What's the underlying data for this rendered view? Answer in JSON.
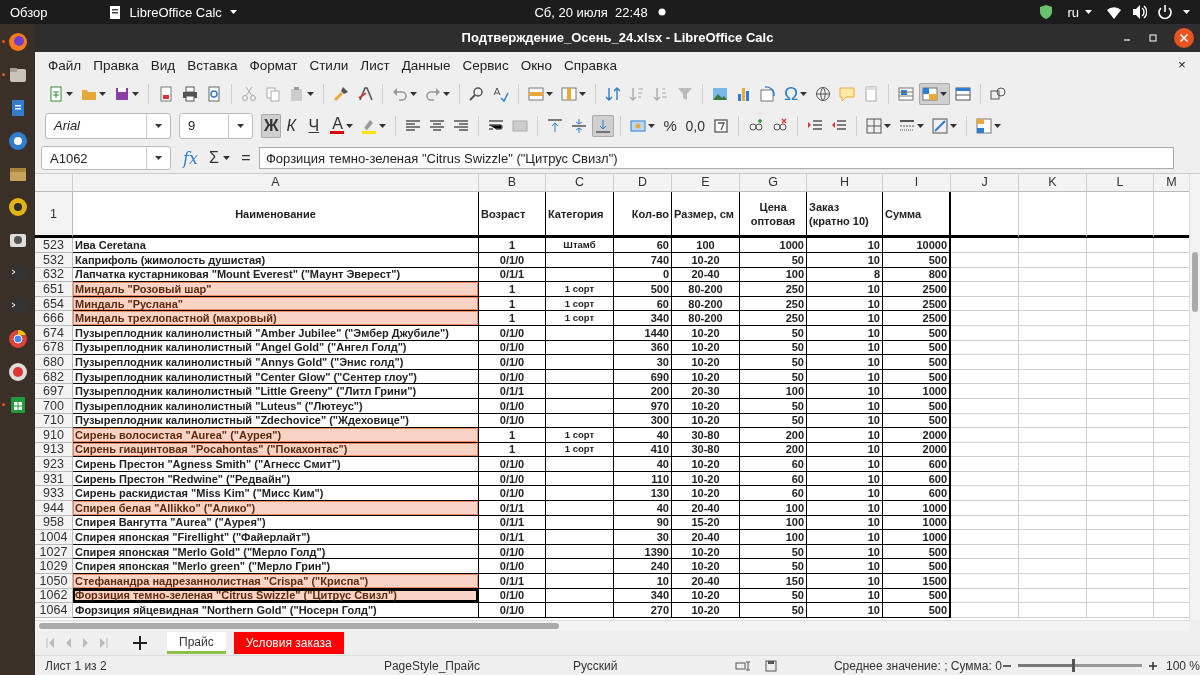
{
  "top_bar": {
    "activities": "Обзор",
    "app_name": "LibreOffice Calc",
    "clock": "Сб, 20 июля  22:48",
    "keyboard_layout": "ru"
  },
  "window": {
    "title": "Подтверждение_Осень_24.xlsx - LibreOffice Calc"
  },
  "menu": [
    "Файл",
    "Правка",
    "Вид",
    "Вставка",
    "Формат",
    "Стили",
    "Лист",
    "Данные",
    "Сервис",
    "Окно",
    "Справка"
  ],
  "menu_close": "×",
  "toolbar": {
    "special_character": "Ω"
  },
  "formatting": {
    "font_name": "Arial",
    "font_size": "9",
    "style_buttons": [
      {
        "label": "Ж",
        "kind": "bold",
        "on": true
      },
      {
        "label": "К",
        "kind": "italic",
        "on": false
      },
      {
        "label": "Ч",
        "kind": "underline",
        "on": false
      }
    ],
    "font_color_label": "A",
    "vertical_align_buttons": [
      {
        "kind": "top",
        "on": false
      },
      {
        "kind": "center",
        "on": false
      },
      {
        "kind": "bottom",
        "on": true
      }
    ],
    "percent": "%",
    "number_format": "0,0"
  },
  "formula_bar": {
    "name_box": "A1062",
    "function_wizard": "fx",
    "sum": "Σ",
    "equals": "=",
    "content": "Форзиция темно-зеленая \"Citrus Swizzle\" (\"Цитрус Свизл\")"
  },
  "columns": [
    "A",
    "B",
    "C",
    "D",
    "E",
    "G",
    "H",
    "I",
    "J",
    "K",
    "L",
    "M"
  ],
  "header_row": {
    "number": "1",
    "cells": [
      "Наименование",
      "Возраст",
      "Категория",
      "Кол-во",
      "Размер, см",
      "Цена оптовая",
      "Заказ (кратно 10)",
      "Сумма"
    ]
  },
  "rows": [
    {
      "number": "523",
      "highlight": false,
      "selected": false,
      "cells": {
        "A": "Ива Ceretana",
        "B": "1",
        "C": "Штамб",
        "D": "60",
        "E": "100",
        "G": "1000",
        "H": "10",
        "I": "10000"
      }
    },
    {
      "number": "532",
      "highlight": false,
      "selected": false,
      "cells": {
        "A": "Каприфоль (жимолость душистая)",
        "B": "0/1/0",
        "D": "740",
        "E": "10-20",
        "G": "50",
        "H": "10",
        "I": "500"
      }
    },
    {
      "number": "632",
      "highlight": false,
      "selected": false,
      "cells": {
        "A": "Лапчатка кустарниковая \"Mount Everest\" (\"Маунт Эверест\")",
        "B": "0/1/1",
        "D": "0",
        "E": "20-40",
        "G": "100",
        "H": "8",
        "I": "800"
      }
    },
    {
      "number": "651",
      "highlight": true,
      "selected": false,
      "cells": {
        "A": "Миндаль \"Розовый шар\"",
        "B": "1",
        "C": "1 сорт",
        "D": "500",
        "E": "80-200",
        "G": "250",
        "H": "10",
        "I": "2500"
      }
    },
    {
      "number": "654",
      "highlight": true,
      "selected": false,
      "cells": {
        "A": "Миндаль \"Руслана\"",
        "B": "1",
        "C": "1 сорт",
        "D": "60",
        "E": "80-200",
        "G": "250",
        "H": "10",
        "I": "2500"
      }
    },
    {
      "number": "666",
      "highlight": true,
      "selected": false,
      "cells": {
        "A": "Миндаль трехлопастной (махровый)",
        "B": "1",
        "C": "1 сорт",
        "D": "340",
        "E": "80-200",
        "G": "250",
        "H": "10",
        "I": "2500"
      }
    },
    {
      "number": "674",
      "highlight": false,
      "selected": false,
      "cells": {
        "A": "Пузыреплодник калинолистный \"Amber Jubilee\" (\"Эмбер Джубиле\")",
        "B": "0/1/0",
        "D": "1440",
        "E": "10-20",
        "G": "50",
        "H": "10",
        "I": "500"
      }
    },
    {
      "number": "678",
      "highlight": false,
      "selected": false,
      "cells": {
        "A": "Пузыреплодник калинолистный \"Angel Gold\" (\"Ангел Голд\")",
        "B": "0/1/0",
        "D": "360",
        "E": "10-20",
        "G": "50",
        "H": "10",
        "I": "500"
      }
    },
    {
      "number": "680",
      "highlight": false,
      "selected": false,
      "cells": {
        "A": "Пузыреплодник калинолистный \"Annys Gold\" (\"Энис голд\")",
        "B": "0/1/0",
        "D": "30",
        "E": "10-20",
        "G": "50",
        "H": "10",
        "I": "500"
      }
    },
    {
      "number": "682",
      "highlight": false,
      "selected": false,
      "cells": {
        "A": "Пузыреплодник калинолистный \"Center Glow\" (\"Сентер глоу\")",
        "B": "0/1/0",
        "D": "690",
        "E": "10-20",
        "G": "50",
        "H": "10",
        "I": "500"
      }
    },
    {
      "number": "697",
      "highlight": false,
      "selected": false,
      "cells": {
        "A": "Пузыреплодник калинолистный \"Little Greeny\" (\"Литл Грини\")",
        "B": "0/1/1",
        "D": "200",
        "E": "20-30",
        "G": "100",
        "H": "10",
        "I": "1000"
      }
    },
    {
      "number": "700",
      "highlight": false,
      "selected": false,
      "cells": {
        "A": "Пузыреплодник калинолистный \"Luteus\" (\"Лютеус\")",
        "B": "0/1/0",
        "D": "970",
        "E": "10-20",
        "G": "50",
        "H": "10",
        "I": "500"
      }
    },
    {
      "number": "710",
      "highlight": false,
      "selected": false,
      "cells": {
        "A": "Пузыреплодник калинолистный \"Zdechovice\" (\"Ждеховице\")",
        "B": "0/1/0",
        "D": "300",
        "E": "10-20",
        "G": "50",
        "H": "10",
        "I": "500"
      }
    },
    {
      "number": "910",
      "highlight": true,
      "selected": false,
      "cells": {
        "A": "Сирень волосистая \"Aurea\" (\"Аурея\")",
        "B": "1",
        "C": "1 сорт",
        "D": "40",
        "E": "30-80",
        "G": "200",
        "H": "10",
        "I": "2000"
      }
    },
    {
      "number": "913",
      "highlight": true,
      "selected": false,
      "cells": {
        "A": "Сирень гиацинтовая \"Pocahontas\" (\"Покахонтас\")",
        "B": "1",
        "C": "1 сорт",
        "D": "410",
        "E": "30-80",
        "G": "200",
        "H": "10",
        "I": "2000"
      }
    },
    {
      "number": "923",
      "highlight": false,
      "selected": false,
      "cells": {
        "A": "Сирень Престон \"Agness Smith\" (\"Агнесс Смит\")",
        "B": "0/1/0",
        "D": "40",
        "E": "10-20",
        "G": "60",
        "H": "10",
        "I": "600"
      }
    },
    {
      "number": "931",
      "highlight": false,
      "selected": false,
      "cells": {
        "A": "Сирень Престон \"Redwine\" (\"Редвайн\")",
        "B": "0/1/0",
        "D": "110",
        "E": "10-20",
        "G": "60",
        "H": "10",
        "I": "600"
      }
    },
    {
      "number": "933",
      "highlight": false,
      "selected": false,
      "cells": {
        "A": "Сирень раскидистая \"Miss Kim\" (\"Мисс Ким\")",
        "B": "0/1/0",
        "D": "130",
        "E": "10-20",
        "G": "60",
        "H": "10",
        "I": "600"
      }
    },
    {
      "number": "944",
      "highlight": true,
      "selected": false,
      "cells": {
        "A": "Спирея белая \"Allikko\" (\"Алико\")",
        "B": "0/1/1",
        "D": "40",
        "E": "20-40",
        "G": "100",
        "H": "10",
        "I": "1000"
      }
    },
    {
      "number": "958",
      "highlight": false,
      "selected": false,
      "cells": {
        "A": "Спирея Вангутта \"Aurea\" (\"Аурея\")",
        "B": "0/1/1",
        "D": "90",
        "E": "15-20",
        "G": "100",
        "H": "10",
        "I": "1000"
      }
    },
    {
      "number": "1004",
      "highlight": false,
      "selected": false,
      "cells": {
        "A": "Спирея японская \"Firellight\" (\"Файерлайт\")",
        "B": "0/1/1",
        "D": "30",
        "E": "20-40",
        "G": "100",
        "H": "10",
        "I": "1000"
      }
    },
    {
      "number": "1027",
      "highlight": false,
      "selected": false,
      "cells": {
        "A": "Спирея японская \"Merlo Gold\" (\"Мерло Голд\")",
        "B": "0/1/0",
        "D": "1390",
        "E": "10-20",
        "G": "50",
        "H": "10",
        "I": "500"
      }
    },
    {
      "number": "1029",
      "highlight": false,
      "selected": false,
      "cells": {
        "A": "Спирея японская \"Merlo green\" (\"Мерло Грин\")",
        "B": "0/1/0",
        "D": "240",
        "E": "10-20",
        "G": "50",
        "H": "10",
        "I": "500"
      }
    },
    {
      "number": "1050",
      "highlight": true,
      "selected": false,
      "cells": {
        "A": "Стефанандра надрезаннолистная \"Crispa\" (\"Криспа\")",
        "B": "0/1/1",
        "D": "10",
        "E": "20-40",
        "G": "150",
        "H": "10",
        "I": "1500"
      }
    },
    {
      "number": "1062",
      "highlight": true,
      "selected": true,
      "cells": {
        "A": "Форзиция темно-зеленая \"Citrus Swizzle\" (\"Цитрус Свизл\")",
        "B": "0/1/0",
        "D": "340",
        "E": "10-20",
        "G": "50",
        "H": "10",
        "I": "500"
      }
    },
    {
      "number": "1064",
      "highlight": false,
      "selected": false,
      "cells": {
        "A": "Форзиция яйцевидная \"Northern Gold\" (\"Носерн Голд\")",
        "B": "0/1/0",
        "D": "270",
        "E": "10-20",
        "G": "50",
        "H": "10",
        "I": "500"
      }
    }
  ],
  "sheet_tabs": [
    {
      "label": "Прайс",
      "selected": true,
      "color": "#8bc34a"
    },
    {
      "label": "Условия заказа",
      "selected": false,
      "color": "#ff0000"
    }
  ],
  "status_bar": {
    "sheet": "Лист 1 из 2",
    "page_style": "PageStyle_Прайс",
    "language": "Русский",
    "summary": "Среднее значение: ; Сумма: 0",
    "zoom": "100 %",
    "zoom_slider": {
      "level": 0.45
    }
  }
}
